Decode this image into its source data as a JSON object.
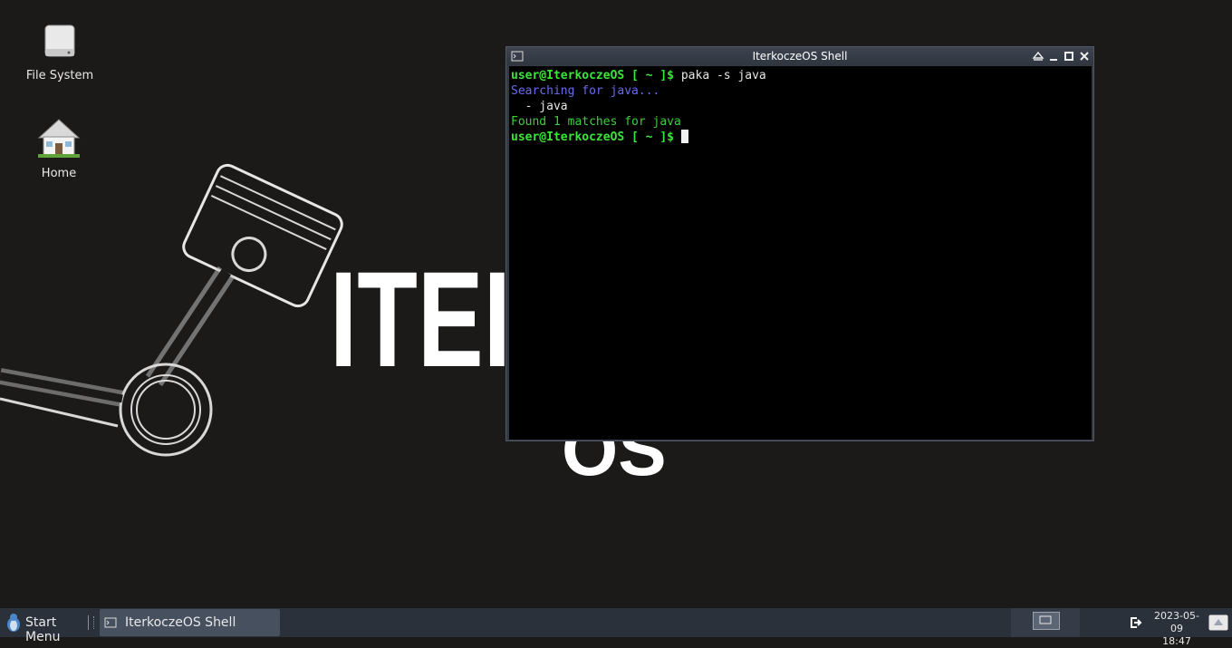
{
  "desktop": {
    "icons": [
      {
        "label": "File System",
        "icon": "drive-icon"
      },
      {
        "label": "Home",
        "icon": "house-icon"
      }
    ],
    "wallpaper": {
      "logo_text_main": "ITEI",
      "logo_text_sub": "OS"
    }
  },
  "terminal": {
    "title": "IterkoczeOS Shell",
    "lines": {
      "prompt": "user@IterkoczeOS [ ~ ]$",
      "command": " paka -s java",
      "searching": "Searching for java...",
      "result_item": "  - java",
      "found": "Found 1 matches for java"
    }
  },
  "taskbar": {
    "start_label": "Start Menu",
    "task_label": "IterkoczeOS Shell",
    "clock_date": "2023-05-09",
    "clock_time": "18:47"
  },
  "colors": {
    "desktop_bg": "#1b1a19",
    "prompt_green": "#39e639",
    "info_blue": "#6a6af0",
    "taskbar_bg": "#2b313b"
  }
}
